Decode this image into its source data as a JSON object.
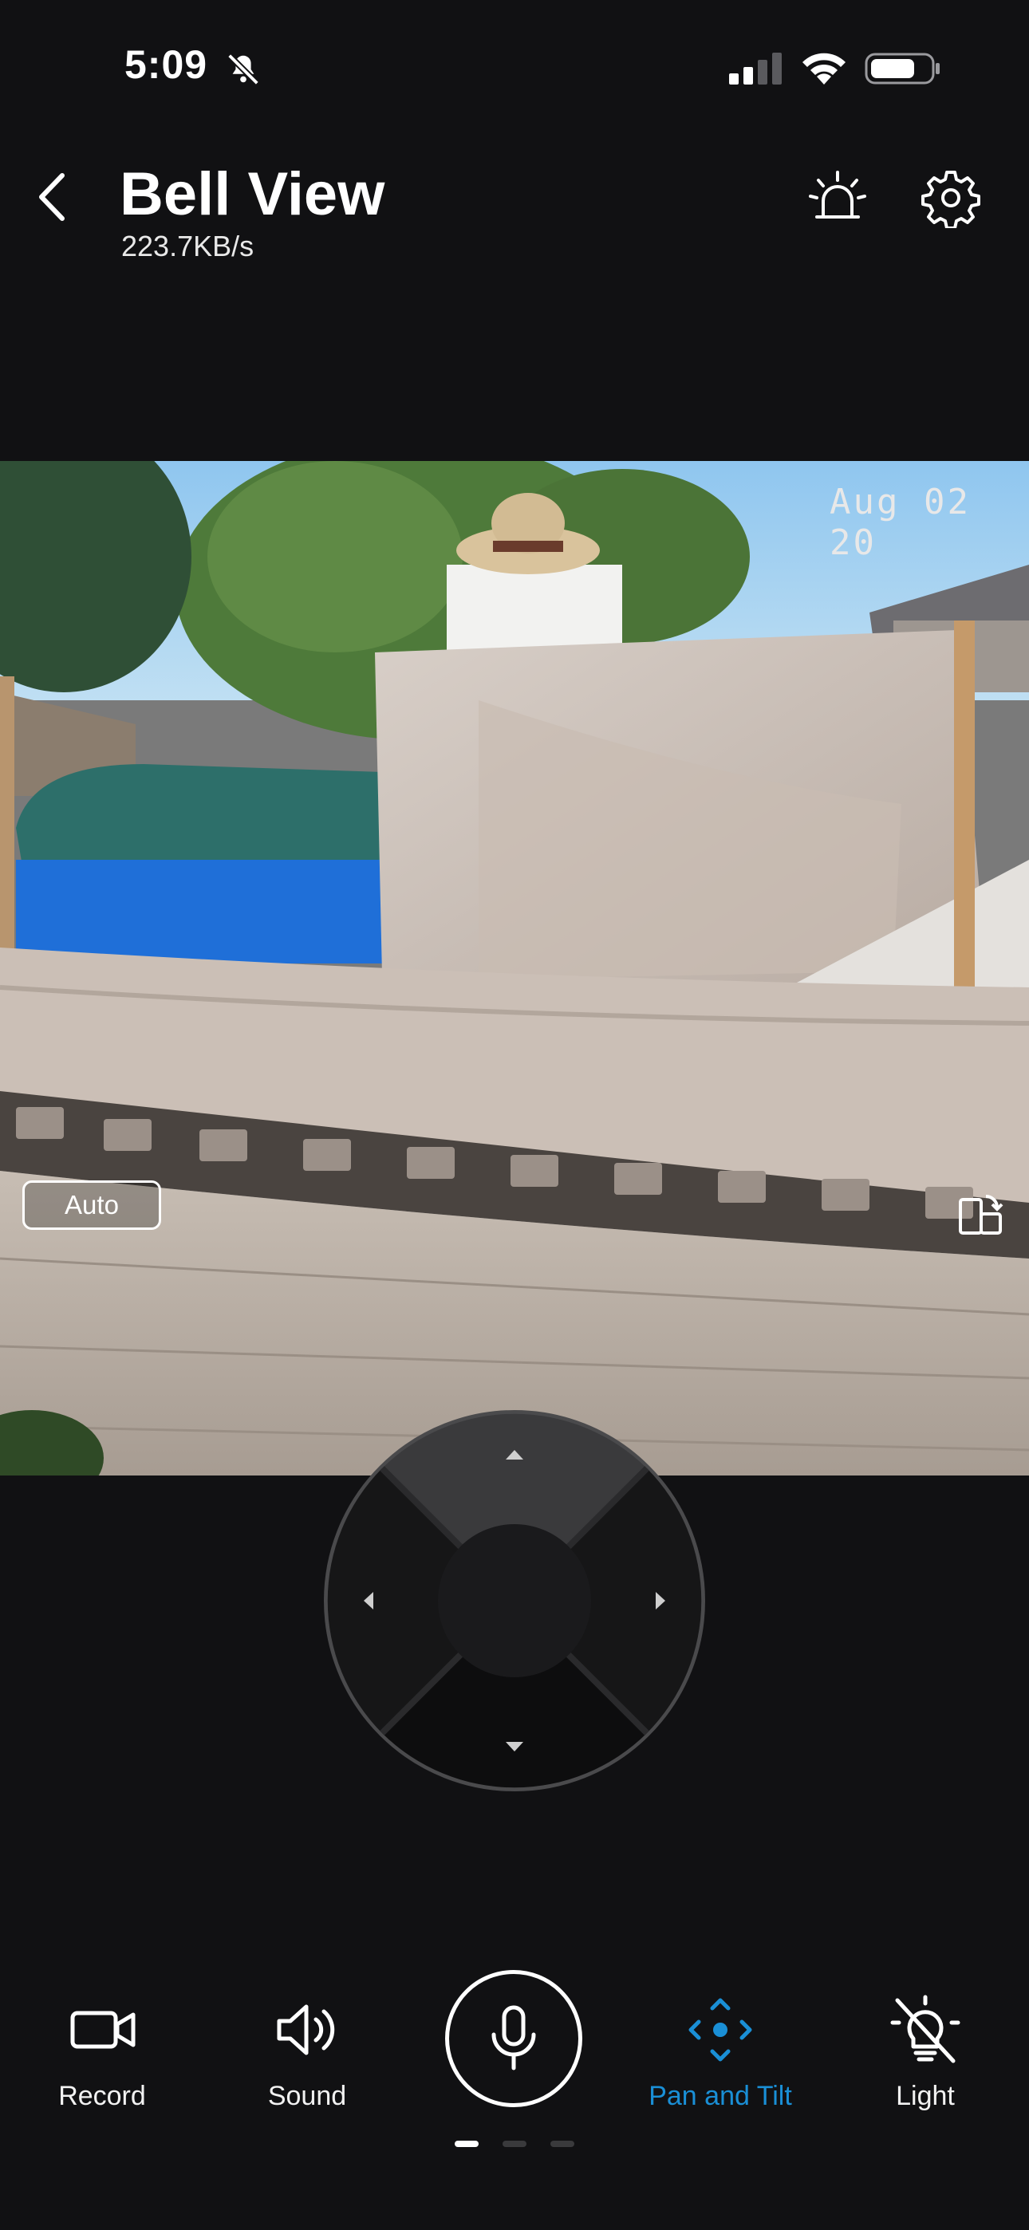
{
  "status_bar": {
    "time": "5:09",
    "icons": [
      "bell-slash-icon",
      "cellular-signal-icon",
      "wifi-icon",
      "battery-icon"
    ]
  },
  "header": {
    "title": "Bell View",
    "bitrate": "223.7KB/s",
    "icons": [
      "back-chevron-icon",
      "siren-alarm-icon",
      "settings-gear-icon"
    ]
  },
  "video": {
    "timestamp": "Aug 02 20",
    "mode_button": "Auto",
    "icons": [
      "rotate-screen-icon"
    ]
  },
  "ptz": {
    "icons": [
      "arrow-up-icon",
      "arrow-left-icon",
      "arrow-right-icon",
      "arrow-down-icon"
    ]
  },
  "toolbar": {
    "items": [
      {
        "label": "Record",
        "icon": "video-camera-icon",
        "active": false
      },
      {
        "label": "Sound",
        "icon": "speaker-icon",
        "active": false
      },
      {
        "label": "",
        "icon": "microphone-icon",
        "active": false
      },
      {
        "label": "Pan and Tilt",
        "icon": "pan-tilt-icon",
        "active": true
      },
      {
        "label": "Light",
        "icon": "light-off-icon",
        "active": false
      }
    ]
  },
  "pager": {
    "pages": 3,
    "current": 1
  },
  "colors": {
    "background": "#111113",
    "accent": "#1a8fd6",
    "text": "#ffffff"
  }
}
